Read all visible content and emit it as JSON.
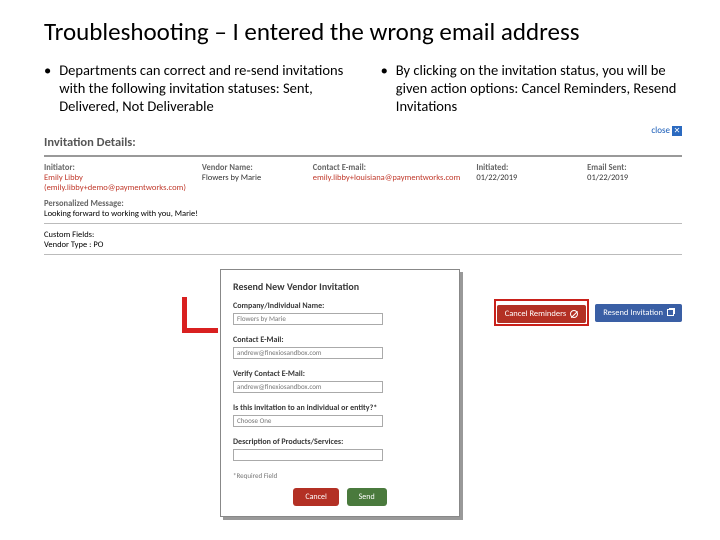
{
  "title": "Troubleshooting – I entered the wrong email address",
  "bullets": {
    "left": "Departments can correct and re-send invitations with the following invitation statuses: Sent, Delivered, Not Deliverable",
    "right": "By clicking on the invitation status, you will be given action options: Cancel Reminders, Resend Invitations"
  },
  "details": {
    "close": "close",
    "heading": "Invitation Details:",
    "col1_h": "Initiator:",
    "col1_v": "Emily Libby (emily.libby+demo@paymentworks.com)",
    "col2_h": "Vendor Name:",
    "col2_v": "Flowers by Marie",
    "col3_h": "Contact E-mail:",
    "col3_v": "emily.libby+louisiana@paymentworks.com",
    "col4_h": "Initiated:",
    "col4_v": "01/22/2019",
    "col5_h": "Email Sent:",
    "col5_v": "01/22/2019",
    "pm_h": "Personalized Message:",
    "pm_v": "Looking forward to working with you, Marie!",
    "cf_h": "Custom Fields:",
    "cf_v": "Vendor Type : PO"
  },
  "actions": {
    "cancel": "Cancel Reminders",
    "resend": "Resend Invitation"
  },
  "modal": {
    "title": "Resend New Vendor Invitation",
    "f1_l": "Company/Individual Name:",
    "f1_v": "Flowers by Marie",
    "f2_l": "Contact E-Mail:",
    "f2_v": "andrew@finexiosandbox.com",
    "f3_l": "Verify Contact E-Mail:",
    "f3_v": "andrew@finexiosandbox.com",
    "f4_l": "Is this invitation to an individual or entity?*",
    "f4_v": "Choose One",
    "f5_l": "Description of Products/Services:",
    "req": "*Required Field",
    "cancel": "Cancel",
    "send": "Send"
  }
}
